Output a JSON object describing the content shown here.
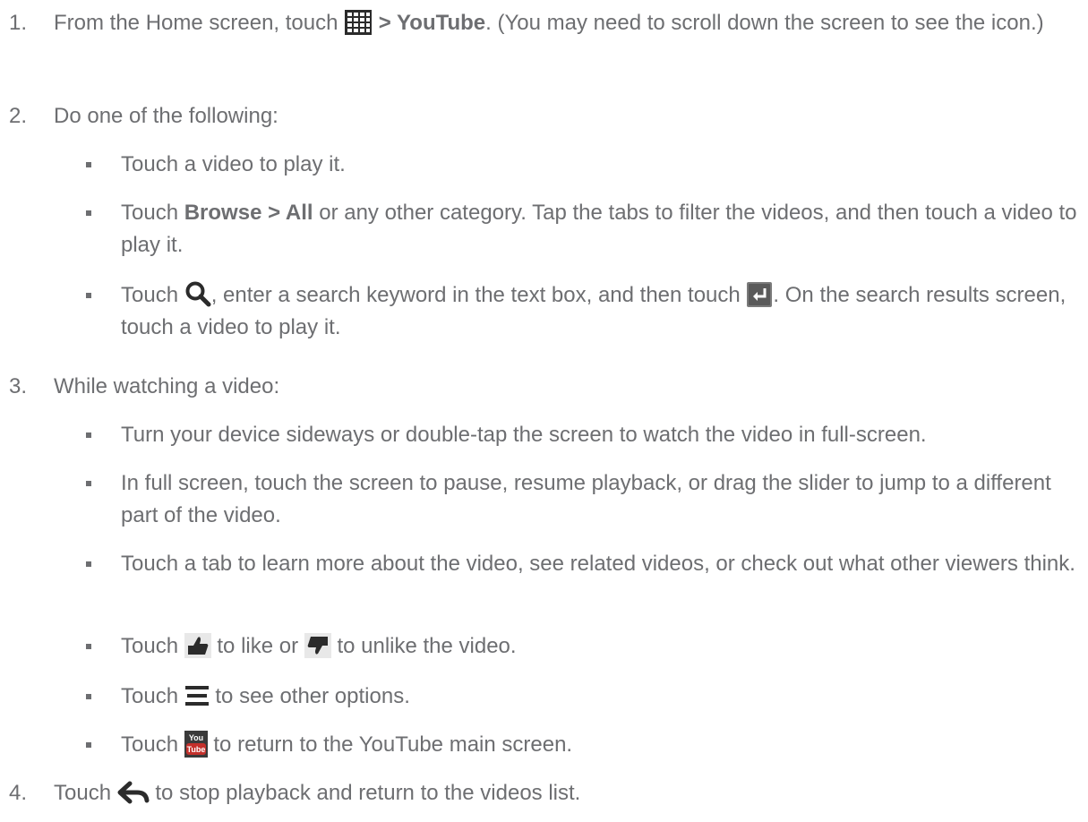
{
  "steps": [
    {
      "num": "1.",
      "a": "From the Home screen, touch",
      "b": " > YouTube",
      "c": ". (You may need to scroll down the screen to see the icon.)"
    },
    {
      "num": "2.",
      "text": "Do one of the following:"
    },
    {
      "num": "3.",
      "text": "While watching a video:"
    },
    {
      "num": "4.",
      "a": "Touch",
      "b": "to stop playback and return to the videos list."
    }
  ],
  "step2_bullets": [
    {
      "text": "Touch a video to play it."
    },
    {
      "a": "Touch ",
      "b": "Browse > All",
      "c": " or any other category. Tap the tabs to filter the videos, and then touch a video to play it."
    },
    {
      "a": "Touch",
      "b": ", enter a search keyword in the text box, and then touch",
      "c": ". On the search results screen, touch a video to play it."
    }
  ],
  "step3_bullets": [
    {
      "text": "Turn your device sideways or double-tap the screen to watch the video in full-screen."
    },
    {
      "text": "In full screen, touch the screen to pause, resume playback, or drag the slider to jump to a different part of the video."
    },
    {
      "text": "Touch a tab to learn more about the video, see related videos, or check out what other viewers think."
    },
    {
      "a": "Touch",
      "b": "to like or",
      "c": "to unlike the video."
    },
    {
      "a": "Touch",
      "b": "to see other options."
    },
    {
      "a": "Touch",
      "b": "to return to the YouTube main screen."
    }
  ],
  "youtube_icon": {
    "top": "You",
    "bottom": "Tube"
  },
  "icons": [
    "apps-grid-icon",
    "search-icon",
    "enter-key-icon",
    "thumbs-up-icon",
    "thumbs-down-icon",
    "menu-icon",
    "youtube-icon",
    "back-icon"
  ],
  "colors": {
    "text": "#6d6e71",
    "icon_dark": "#2b2b2b",
    "youtube_red": "#c4302b"
  }
}
